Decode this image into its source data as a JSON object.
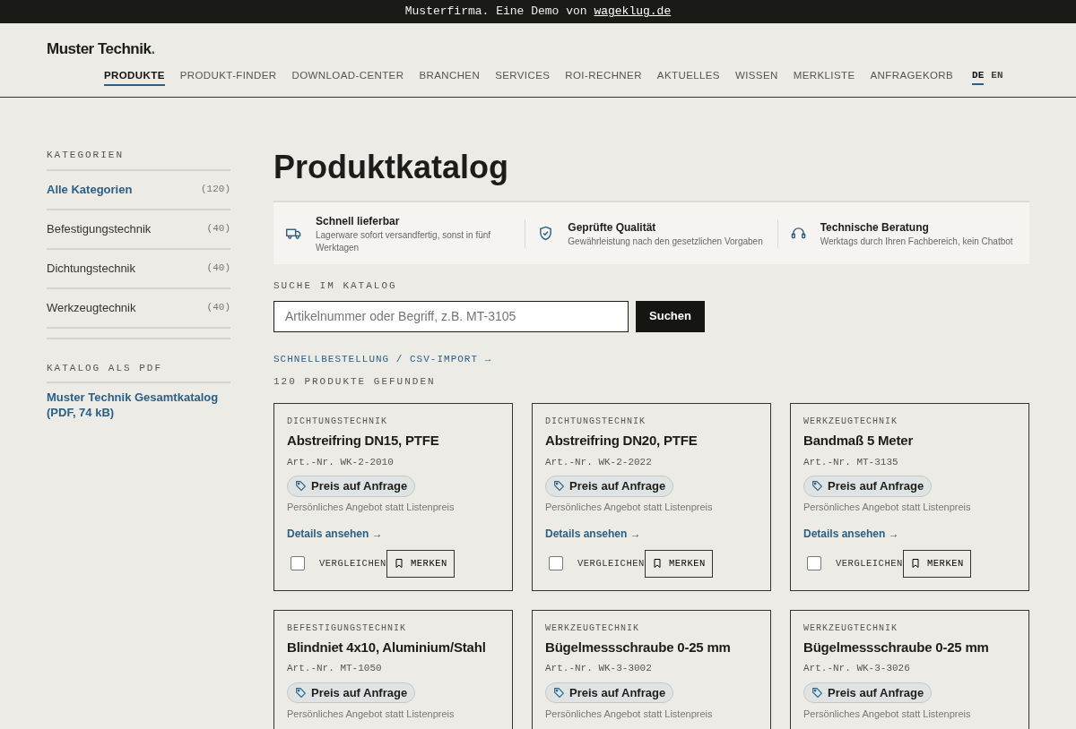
{
  "top_bar": {
    "text": "Musterfirma. Eine Demo von",
    "link": "wageklug.de"
  },
  "header": {
    "logo": "Muster Technik",
    "logo_dot": ".",
    "nav": [
      {
        "label": "PRODUKTE",
        "selected": true
      },
      {
        "label": "PRODUKT-FINDER",
        "selected": false
      },
      {
        "label": "DOWNLOAD-CENTER",
        "selected": false
      },
      {
        "label": "BRANCHEN",
        "selected": false
      },
      {
        "label": "SERVICES",
        "selected": false
      },
      {
        "label": "ROI-RECHNER",
        "selected": false
      },
      {
        "label": "AKTUELLES",
        "selected": false
      },
      {
        "label": "WISSEN",
        "selected": false
      },
      {
        "label": "MERKLISTE",
        "selected": false
      },
      {
        "label": "ANFRAGEKORB",
        "selected": false
      }
    ],
    "languages": [
      {
        "label": "DE",
        "selected": true
      },
      {
        "label": "EN",
        "selected": false
      }
    ]
  },
  "sidebar": {
    "categories_title": "KATEGORIEN",
    "categories": [
      {
        "label": "Alle Kategorien",
        "count": "(120)",
        "selected": true
      },
      {
        "label": "Befestigungstechnik",
        "count": "(40)",
        "selected": false
      },
      {
        "label": "Dichtungstechnik",
        "count": "(40)",
        "selected": false
      },
      {
        "label": "Werkzeugtechnik",
        "count": "(40)",
        "selected": false
      }
    ],
    "pdf_title": "KATALOG ALS PDF",
    "pdf_link": "Muster Technik Gesamtkatalog (PDF, 74 kB)"
  },
  "page_title": "Produktkatalog",
  "features": [
    {
      "kind": "truck",
      "title": "Schnell lieferbar",
      "text": "Lagerware sofort versandfertig, sonst in fünf Werktagen"
    },
    {
      "kind": "shield",
      "title": "Geprüfte Qualität",
      "text": "Gewährleistung nach den gesetzlichen Vorgaben"
    },
    {
      "kind": "headset",
      "title": "Technische Beratung",
      "text": "Werktags durch Ihren Fachbereich, kein Chatbot"
    }
  ],
  "search": {
    "label": "SUCHE IM KATALOG",
    "placeholder": "Artikelnummer oder Begriff, z.B. MT-3105",
    "button": "Suchen"
  },
  "quick_order_link": "SCHNELLBESTELLUNG / CSV-IMPORT →",
  "result_count": "120 PRODUKTE GEFUNDEN",
  "products": [
    {
      "category": "DICHTUNGSTECHNIK",
      "name": "Abstreifring DN15, PTFE",
      "sku": "Art.-Nr. WK-2-2010",
      "price": "Preis auf Anfrage",
      "note": "Persönliches Angebot statt Listenpreis",
      "details": "Details ansehen →",
      "compare": {
        "label": "VERGLEICHEN",
        "checked": false
      },
      "save": "MERKEN"
    },
    {
      "category": "DICHTUNGSTECHNIK",
      "name": "Abstreifring DN20, PTFE",
      "sku": "Art.-Nr. WK-2-2022",
      "price": "Preis auf Anfrage",
      "note": "Persönliches Angebot statt Listenpreis",
      "details": "Details ansehen →",
      "compare": {
        "label": "VERGLEICHEN",
        "checked": false
      },
      "save": "MERKEN"
    },
    {
      "category": "WERKZEUGTECHNIK",
      "name": "Bandmaß 5 Meter",
      "sku": "Art.-Nr. MT-3135",
      "price": "Preis auf Anfrage",
      "note": "Persönliches Angebot statt Listenpreis",
      "details": "Details ansehen →",
      "compare": {
        "label": "VERGLEICHEN",
        "checked": false
      },
      "save": "MERKEN"
    },
    {
      "category": "BEFESTIGUNGSTECHNIK",
      "name": "Blindniet 4x10, Aluminium/Stahl",
      "sku": "Art.-Nr. MT-1050",
      "price": "Preis auf Anfrage",
      "note": "Persönliches Angebot statt Listenpreis"
    },
    {
      "category": "WERKZEUGTECHNIK",
      "name": "Bügelmessschraube 0-25 mm",
      "sku": "Art.-Nr. WK-3-3002",
      "price": "Preis auf Anfrage",
      "note": "Persönliches Angebot statt Listenpreis"
    },
    {
      "category": "WERKZEUGTECHNIK",
      "name": "Bügelmessschraube 0-25 mm",
      "sku": "Art.-Nr. WK-3-3026",
      "price": "Preis auf Anfrage",
      "note": "Persönliches Angebot statt Listenpreis"
    }
  ]
}
